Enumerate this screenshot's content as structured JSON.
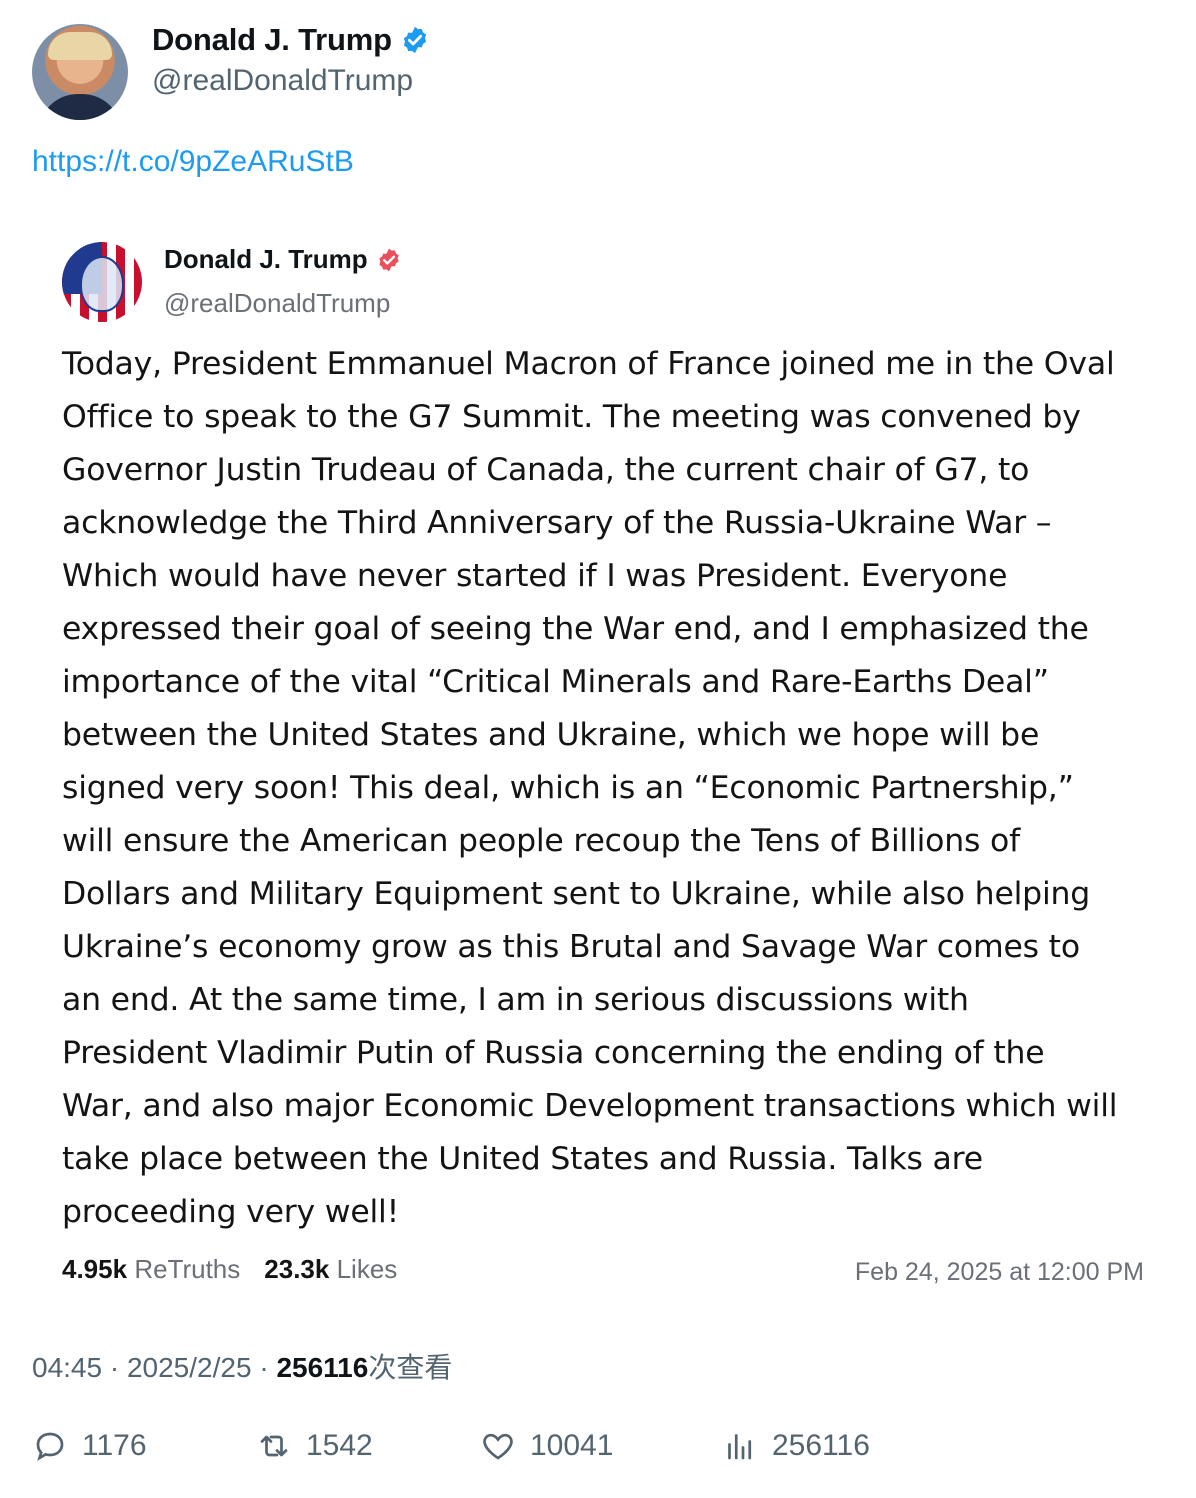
{
  "tweet": {
    "author": {
      "name": "Donald J. Trump",
      "handle": "@realDonaldTrump",
      "verified_color": "#1d9bf0"
    },
    "link": "https://t.co/9pZeARuStB",
    "quoted": {
      "author": {
        "name": "Donald J. Trump",
        "handle": "@realDonaldTrump",
        "verified_color": "#ec4e5e"
      },
      "body_lines": [
        "Today, President Emmanuel Macron of France joined me in the Oval",
        "Office to speak to the G7 Summit. The meeting was convened by",
        "Governor Justin Trudeau of Canada, the current chair of G7, to",
        "acknowledge the Third Anniversary of the Russia-Ukraine War –",
        "Which would have never started if I was President. Everyone",
        "expressed their goal of seeing the War end, and I emphasized the",
        "importance of the vital “Critical Minerals and Rare-Earths Deal”",
        "between the United States and Ukraine, which we hope will be",
        "signed very soon! This deal, which is an “Economic Partnership,”",
        "will ensure the American people recoup the Tens of Billions of",
        "Dollars and Military Equipment sent to Ukraine, while also helping",
        "Ukraine’s economy grow as this Brutal and Savage War comes to",
        "an end. At the same time, I am in serious discussions with",
        "President Vladimir Putin of Russia concerning the ending of the",
        "War, and also major Economic Development transactions which will",
        "take place between the United States and Russia. Talks are",
        "proceeding very well!"
      ],
      "retruths_count": "4.95k",
      "retruths_label": "ReTruths",
      "likes_count": "23.3k",
      "likes_label": "Likes",
      "date": "Feb 24, 2025 at 12:00 PM"
    },
    "meta": {
      "time": "04:45",
      "date": "2025/2/25",
      "views": "256116",
      "views_label": "次查看"
    },
    "actions": {
      "replies": "1176",
      "reposts": "1542",
      "likes": "10041",
      "views": "256116"
    }
  }
}
